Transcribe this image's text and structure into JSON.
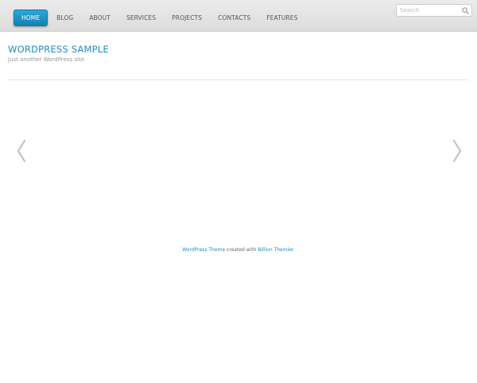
{
  "nav": {
    "items": [
      {
        "label": "HOME"
      },
      {
        "label": "BLOG"
      },
      {
        "label": "ABOUT"
      },
      {
        "label": "SERVICES"
      },
      {
        "label": "PROJECTS"
      },
      {
        "label": "CONTACTS"
      },
      {
        "label": "FEATURES"
      }
    ],
    "active_index": 0
  },
  "search": {
    "placeholder": "Search",
    "value": "",
    "icon": "search-icon"
  },
  "header": {
    "title": "WORDPRESS SAMPLE",
    "tagline": "Just another WordPress site"
  },
  "slider": {
    "prev_icon": "chevron-left-icon",
    "next_icon": "chevron-right-icon"
  },
  "footer": {
    "link1": "WordPress Theme",
    "middle": " created with ",
    "link2": "Billion Themler",
    "end": "."
  },
  "colors": {
    "accent": "#1e8cc2",
    "active_nav_top": "#2aa8d6",
    "active_nav_bottom": "#1580b3",
    "topbar": "#e4e4e4"
  }
}
